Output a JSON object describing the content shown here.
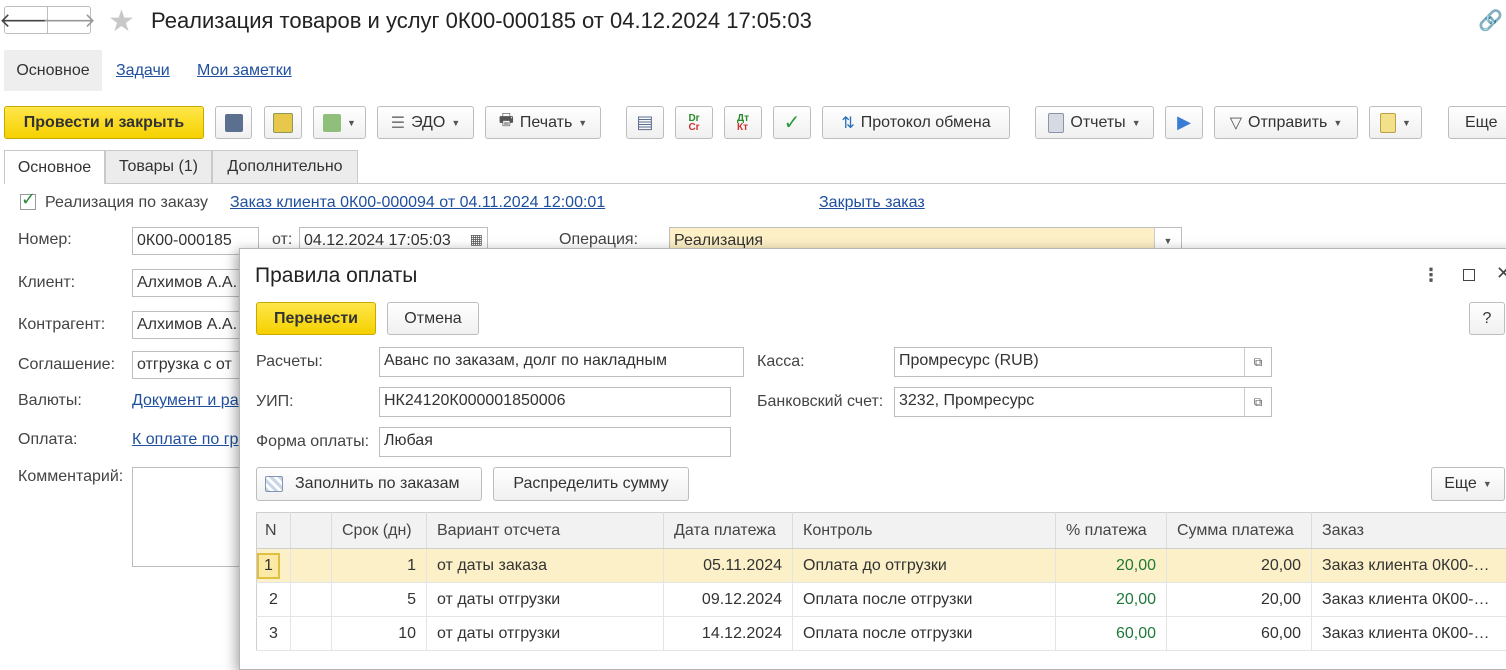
{
  "window": {
    "title": "Реализация товаров и услуг 0К00-000185 от 04.12.2024 17:05:03",
    "back": "🡐",
    "forward": "🡒"
  },
  "nav": {
    "tabs": [
      "Основное",
      "Задачи",
      "Мои заметки"
    ]
  },
  "toolbar": {
    "post_close": "Провести и закрыть",
    "edo": "ЭДО",
    "print": "Печать",
    "protocol": "Протокол обмена",
    "reports": "Отчеты",
    "send": "Отправить",
    "more": "Еще"
  },
  "form_tabs": [
    "Основное",
    "Товары (1)",
    "Дополнительно"
  ],
  "form": {
    "by_order_label": "Реализация по заказу",
    "order_link": "Заказ клиента 0К00-000094 от 04.11.2024 12:00:01",
    "close_order": "Закрыть заказ",
    "number_label": "Номер:",
    "number": "0К00-000185",
    "from_label": "от:",
    "date": "04.12.2024 17:05:03",
    "operation_label": "Операция:",
    "operation": "Реализация",
    "client_label": "Клиент:",
    "client": "Алхимов А.А.",
    "contractor_label": "Контрагент:",
    "contractor": "Алхимов А.А.",
    "agreement_label": "Соглашение:",
    "agreement": "отгрузка с от",
    "currency_label": "Валюты:",
    "currency_link": "Документ и ра",
    "payment_label": "Оплата:",
    "payment_link": "К оплате по гр",
    "comment_label": "Комментарий:"
  },
  "dialog": {
    "title": "Правила оплаты",
    "transfer": "Перенести",
    "cancel": "Отмена",
    "help": "?",
    "settlements_label": "Расчеты:",
    "settlements": "Аванс по заказам, долг по накладным",
    "cash_label": "Касса:",
    "cash": "Промресурс (RUB)",
    "uip_label": "УИП:",
    "uip": "НК24120К000001850006",
    "bank_label": "Банковский счет:",
    "bank": "3232, Промресурс",
    "form_label": "Форма оплаты:",
    "form_value": "Любая",
    "fill_by_orders": "Заполнить по заказам",
    "distribute": "Распределить сумму",
    "more": "Еще",
    "columns": [
      "N",
      "",
      "Срок (дн)",
      "Вариант отсчета",
      "Дата платежа",
      "Контроль",
      "% платежа",
      "Сумма платежа",
      "Заказ"
    ],
    "rows": [
      [
        "1",
        "",
        "1",
        "от даты заказа",
        "05.11.2024",
        "Оплата до отгрузки",
        "20,00",
        "20,00",
        "Заказ клиента 0К00-…"
      ],
      [
        "2",
        "",
        "5",
        "от даты отгрузки",
        "09.12.2024",
        "Оплата после отгрузки",
        "20,00",
        "20,00",
        "Заказ клиента 0К00-…"
      ],
      [
        "3",
        "",
        "10",
        "от даты отгрузки",
        "14.12.2024",
        "Оплата после отгрузки",
        "60,00",
        "60,00",
        "Заказ клиента 0К00-…"
      ]
    ]
  }
}
